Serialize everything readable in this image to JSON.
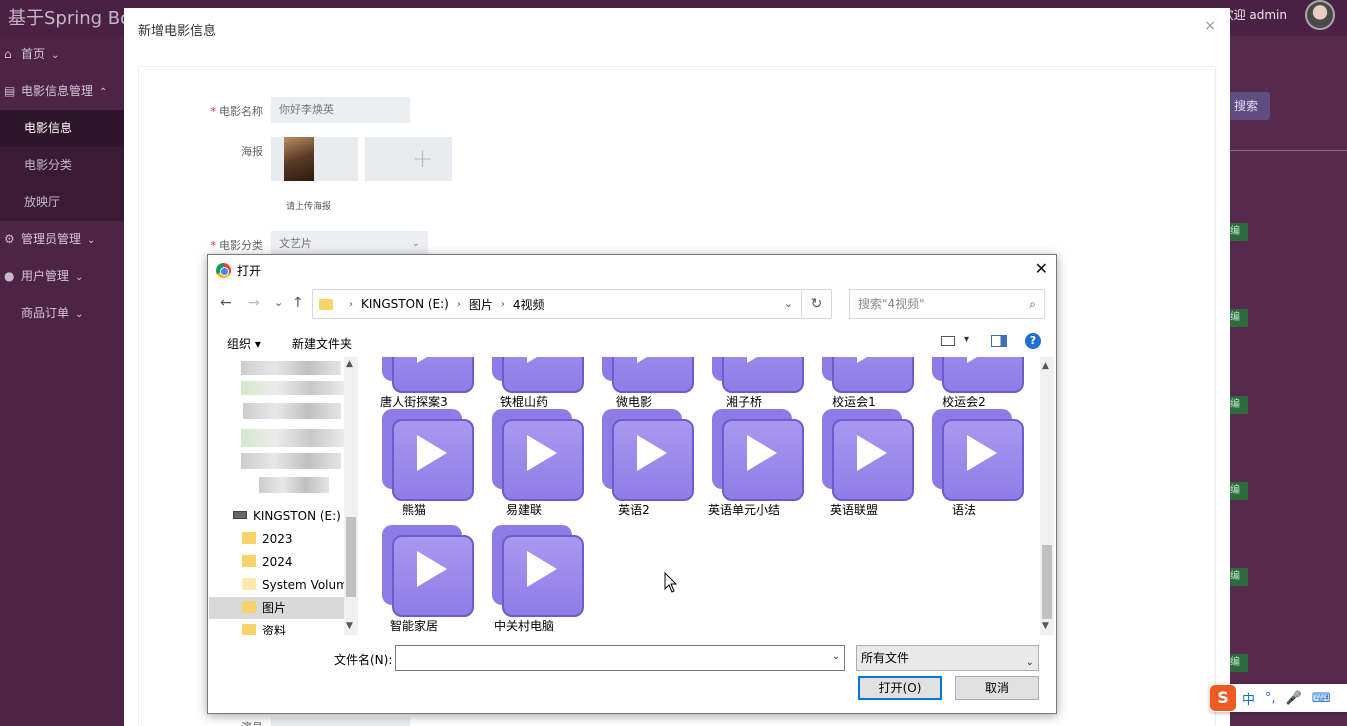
{
  "background": {
    "brand": "基于Spring Boo",
    "welcome": "欢迎 admin",
    "search_label": "搜索",
    "tag_label": "编",
    "nav": [
      {
        "label": "首页",
        "icon": "home-icon",
        "sub": false,
        "active": false,
        "caret": "⌄"
      },
      {
        "label": "电影信息管理",
        "icon": "store-icon",
        "sub": false,
        "active": false,
        "caret": "⌃"
      },
      {
        "label": "电影信息",
        "icon": "",
        "sub": true,
        "active": true,
        "caret": ""
      },
      {
        "label": "电影分类",
        "icon": "",
        "sub": true,
        "active": false,
        "caret": ""
      },
      {
        "label": "放映厅",
        "icon": "",
        "sub": true,
        "active": false,
        "caret": ""
      },
      {
        "label": "管理员管理",
        "icon": "gear-icon",
        "sub": false,
        "active": false,
        "caret": "⌄"
      },
      {
        "label": "用户管理",
        "icon": "user-icon",
        "sub": false,
        "active": false,
        "caret": "⌄"
      },
      {
        "label": "商品订单",
        "icon": "",
        "sub": false,
        "active": false,
        "caret": "⌄"
      }
    ]
  },
  "modal": {
    "title": "新增电影信息",
    "close": "×",
    "form": {
      "movie_name_label": "电影名称",
      "movie_name_value": "你好李焕英",
      "poster_label": "海报",
      "upload_hint": "请上传海报",
      "category_label": "电影分类",
      "category_value": "文艺片",
      "bottom_label": "演员"
    }
  },
  "dialog": {
    "title": "打开",
    "close": "✕",
    "nav": {
      "back": "←",
      "forward": "→",
      "recent": "⌄",
      "up": "↑"
    },
    "breadcrumb": [
      "KINGSTON (E:)",
      "图片",
      "4视频"
    ],
    "refresh": "↻",
    "search_placeholder": "搜索\"4视频\"",
    "toolbar": {
      "organize": "组织 ▾",
      "new_folder": "新建文件夹",
      "help": "?"
    },
    "tree": [
      {
        "label": "KINGSTON (E:)",
        "kind": "drive",
        "selected": false
      },
      {
        "label": "2023",
        "kind": "folder",
        "selected": false
      },
      {
        "label": "2024",
        "kind": "folder",
        "selected": false
      },
      {
        "label": "System Volume",
        "kind": "folder-pale",
        "selected": false
      },
      {
        "label": "图片",
        "kind": "folder",
        "selected": true
      },
      {
        "label": "资料",
        "kind": "folder",
        "selected": false
      }
    ],
    "files_row0": [
      "唐人街探案3",
      "铁棍山药",
      "微电影",
      "湘子桥",
      "校运会1",
      "校运会2"
    ],
    "files_row1": [
      "熊猫",
      "易建联",
      "英语2",
      "英语单元小结",
      "英语联盟",
      "语法"
    ],
    "files_row2": [
      "智能家居",
      "中关村电脑"
    ],
    "filename_label": "文件名(N):",
    "filename_value": "",
    "filetype": "所有文件",
    "open_button": "打开(O)",
    "cancel_button": "取消"
  },
  "ime": {
    "logo": "S",
    "items": [
      "中",
      "°,",
      "🎤",
      "⌨"
    ]
  }
}
